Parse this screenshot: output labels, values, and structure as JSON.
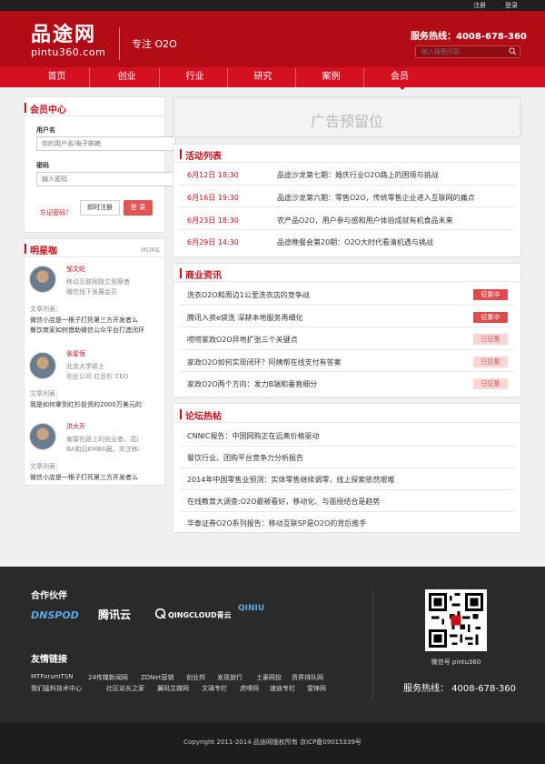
{
  "topbar": {
    "register": "注册",
    "login": "登录"
  },
  "header": {
    "logo": "品途网",
    "logo_sub": "pintu360.com",
    "slogan": "专注 O2O",
    "hotline": "服务热线：4008-678-360",
    "search_placeholder": "输入搜索内容"
  },
  "nav": {
    "items": [
      "首页",
      "创业",
      "行业",
      "研究",
      "案例",
      "会员"
    ]
  },
  "member": {
    "title": "会员中心",
    "username_label": "用户名",
    "username_placeholder": "你的用户名/电子邮箱",
    "password_label": "密码",
    "password_placeholder": "输入密码",
    "forgot": "忘记密码？",
    "register": "即时注册",
    "login": "登 录"
  },
  "experts": {
    "title": "明星咖",
    "more": "MORE",
    "article_label": "文章列表：",
    "items": [
      {
        "name": "邹文屹",
        "desc1": "移动互联网独立观察者",
        "desc2": "微信线下发展会员",
        "article": "微信小店是一根子打死第三方开发者么",
        "article2": "餐饮商家如何借助微信公众平台打造闭环"
      },
      {
        "name": "张星恒",
        "desc1": "北京大学硕士",
        "desc2": "创业公司 红豆杉 CEO",
        "article": "我是如何拿到红杉投资的2000万美元的"
      },
      {
        "name": "洪大开",
        "desc1": "匍匐在路上的创业者，混过M",
        "desc2": "BA和后EMBA圈。关注移动...",
        "article": "微信小店是一根子打死第三方开发者么"
      }
    ]
  },
  "ad": {
    "text": "广告预留位"
  },
  "events": {
    "title": "活动列表",
    "items": [
      {
        "date": "6月12日 18:30",
        "title": "品途沙龙第七期：婚庆行业O2O路上的困境与挑战"
      },
      {
        "date": "6月16日 19:30",
        "title": "品途沙龙第六期：零售O2O，传统零售企业进入互联网的痛点"
      },
      {
        "date": "6月23日 18:30",
        "title": "农产品O2O，用户参与感和用户体验成就有机食品未来"
      },
      {
        "date": "6月29日 14:30",
        "title": "品途晚餐会第20期：O2O大时代看清机遇与挑战"
      }
    ]
  },
  "business": {
    "title": "商业资讯",
    "items": [
      {
        "title": "洗衣O2O和周边1公里洗衣店的竞争战",
        "badge": "征集中",
        "active": true
      },
      {
        "title": "腾讯入资e袋洗 深耕本地服务再细化",
        "badge": "征集中",
        "active": true
      },
      {
        "title": "唠唠家政O2O异地扩张三个关键点",
        "badge": "已征集",
        "active": false
      },
      {
        "title": "家政O2O如何实现闭环？阿姨帮在线支付有答案",
        "badge": "已征集",
        "active": false
      },
      {
        "title": "家政O2O两个方向：发力B端和垂直细分",
        "badge": "已征集",
        "active": false
      }
    ]
  },
  "forum": {
    "title": "论坛热帖",
    "items": [
      "CNNIC报告：中国网购正在远离价格驱动",
      "餐饮行业、团购平台竞争力分析报告",
      "2014年中国零售业预测：实体零售继续调零，线上探索依然艰难",
      "在线教育大调查:O2O最被看好，移动化、与面授结合是趋势",
      "华泰证券O2O系列报告：移动互联SP是O2O的背后推手"
    ]
  },
  "footer": {
    "partners_title": "合作伙伴",
    "partners": [
      "DNSPOD",
      "腾讯云",
      "QINGCLOUD青云",
      "QINIU"
    ],
    "links_title": "友情链接",
    "links_row1": [
      "MTForumTSN",
      "24传媒新闻网",
      "ZDNet营销",
      "创业邦",
      "发现旅行",
      "土豪网投",
      "资界排队网"
    ],
    "links_row2": [
      "我们猛料技术中心",
      "社区站长之家",
      "翼码艾媒网",
      "文璃专栏",
      "虎嗅网",
      "速途专栏",
      "雷锋网"
    ],
    "wechat": "微信号 pintu360",
    "hotline": "服务热线： 4008-678-360",
    "copyright": "Copyright 2011-2014 品途网版权所有     京ICP备09015339号"
  }
}
